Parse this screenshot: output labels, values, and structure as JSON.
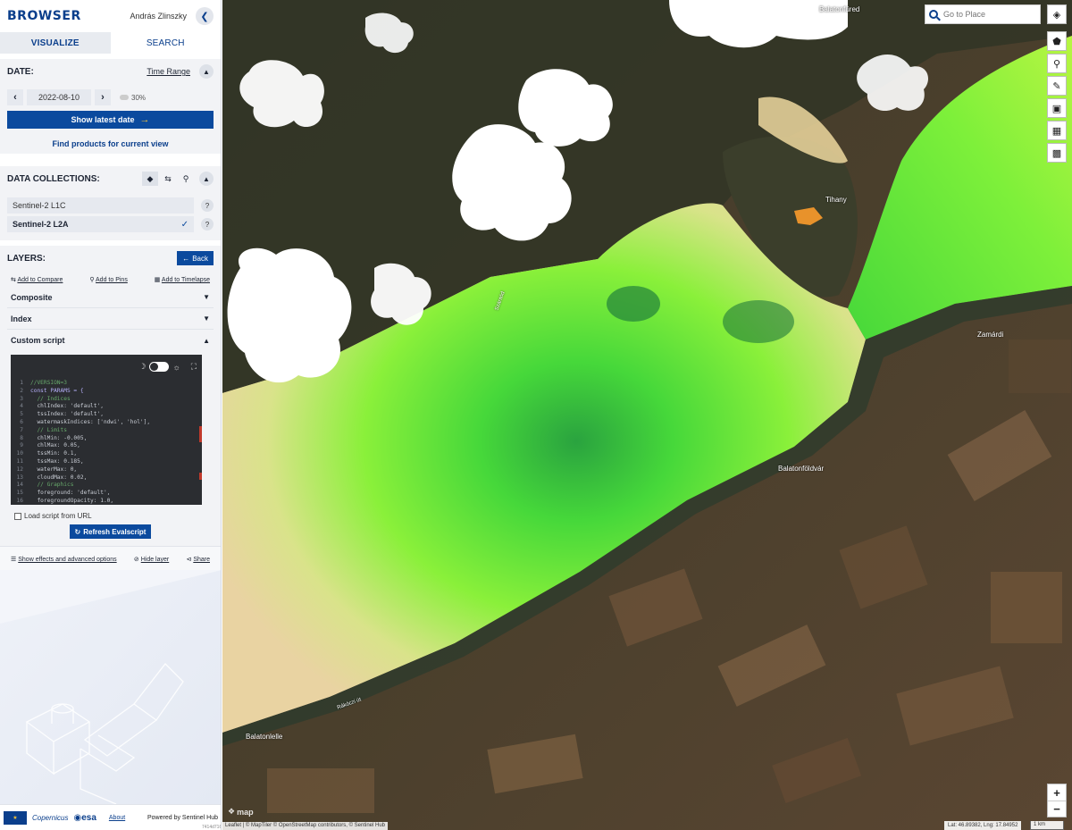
{
  "app": {
    "logo": "BROWSER",
    "user": "András Zlinszky"
  },
  "tabs": [
    {
      "label": "VISUALIZE"
    },
    {
      "label": "SEARCH"
    }
  ],
  "date": {
    "title": "DATE:",
    "time_range": "Time Range",
    "value": "2022-08-10",
    "cloud": "30%",
    "show_latest": "Show latest date",
    "find_products": "Find products for current view"
  },
  "collections": {
    "title": "DATA COLLECTIONS:",
    "items": [
      {
        "label": "Sentinel-2 L1C",
        "selected": false
      },
      {
        "label": "Sentinel-2 L2A",
        "selected": true
      }
    ]
  },
  "layers": {
    "title": "LAYERS:",
    "back": "Back",
    "actions": [
      "Add to Compare",
      "Add to Pins",
      "Add to Timelapse"
    ],
    "accordion": [
      "Composite",
      "Index",
      "Custom script"
    ],
    "code": [
      {
        "n": "1",
        "t": "//VERSION=3",
        "c": "comment"
      },
      {
        "n": "2",
        "t": "const PARAMS = {",
        "c": "kw"
      },
      {
        "n": "3",
        "t": "  // Indices",
        "c": "comment"
      },
      {
        "n": "4",
        "t": "  chlIndex: 'default',",
        "c": ""
      },
      {
        "n": "5",
        "t": "  tssIndex: 'default',",
        "c": ""
      },
      {
        "n": "6",
        "t": "  watermaskIndices: ['ndwi', 'hol'],",
        "c": ""
      },
      {
        "n": "7",
        "t": "  // Limits",
        "c": "comment"
      },
      {
        "n": "8",
        "t": "  chlMin: -0.005,",
        "c": ""
      },
      {
        "n": "9",
        "t": "  chlMax: 0.05,",
        "c": ""
      },
      {
        "n": "10",
        "t": "  tssMin: 0.1,",
        "c": ""
      },
      {
        "n": "11",
        "t": "  tssMax: 0.185,",
        "c": ""
      },
      {
        "n": "12",
        "t": "  waterMax: 0,",
        "c": ""
      },
      {
        "n": "13",
        "t": "  cloudMax: 0.02,",
        "c": ""
      },
      {
        "n": "14",
        "t": "  // Graphics",
        "c": "comment"
      },
      {
        "n": "15",
        "t": "  foreground: 'default',",
        "c": ""
      },
      {
        "n": "16",
        "t": "  foregroundOpacity: 1.0,",
        "c": ""
      }
    ],
    "load_url": "Load script from URL",
    "refresh": "Refresh Evalscript",
    "bottom": [
      "Show effects and advanced options",
      "Hide layer",
      "Share"
    ]
  },
  "footer": {
    "copernicus": "opernicus",
    "esa": "esa",
    "about": "About",
    "powered": "Powered by Sentinel Hub",
    "version": "7414d716"
  },
  "map": {
    "search_placeholder": "Go to Place",
    "places": [
      "Balatonfüred",
      "Tihany",
      "Szántód",
      "Zamárdi",
      "Balatonföldvár",
      "Balatonlelle",
      "Rákóczi út"
    ],
    "maptiler": "map",
    "attribution": "Leaflet | © MapTiler © OpenStreetMap contributors, © Sentinel Hub",
    "coords": "Lat: 46.89382, Lng: 17.84952",
    "scale": "1 km"
  }
}
